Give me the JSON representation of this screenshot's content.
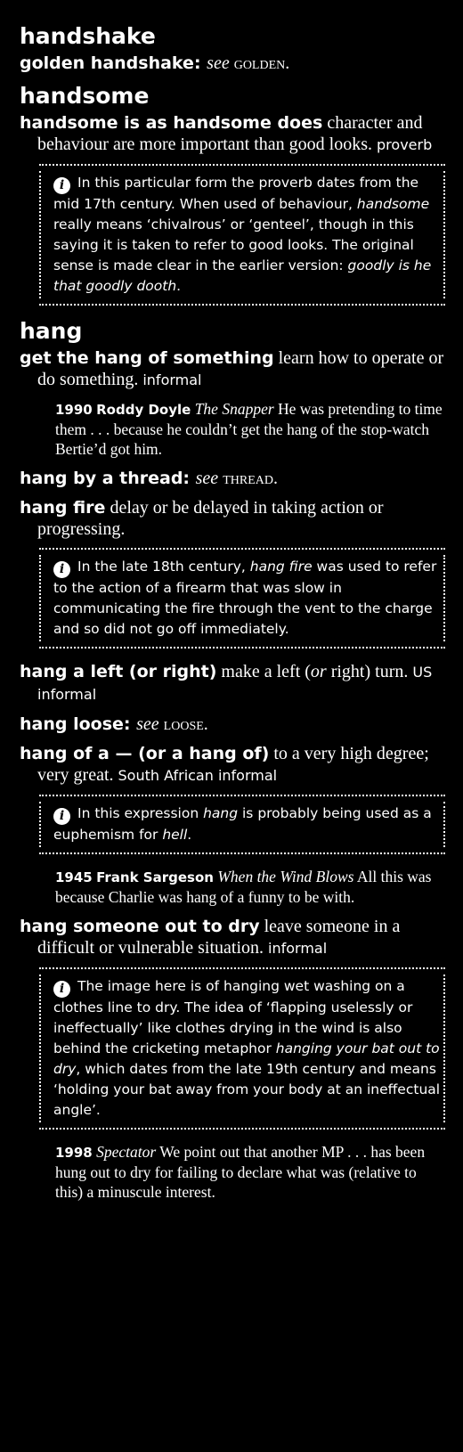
{
  "sections": {
    "handshake": {
      "headword": "handshake",
      "e1": {
        "phrase": "golden handshake",
        "sep": ": ",
        "see": "see",
        "ref": "golden",
        "end": "."
      }
    },
    "handsome": {
      "headword": "handsome",
      "e1": {
        "phrase": "handsome is as handsome does",
        "def": " character and behaviour are more important than good looks.",
        "label": "proverb",
        "note": {
          "t1": "In this particular form the proverb dates from the mid 17th century. When used of behaviour, ",
          "i1": "handsome",
          "t2": " really means ‘chivalrous’ or ‘genteel’, though in this saying it is taken to refer to good looks. The original sense is made clear in the earlier version: ",
          "i2": "goodly is he that goodly dooth",
          "t3": "."
        }
      }
    },
    "hang": {
      "headword": "hang",
      "e1": {
        "phrase": "get the hang of something",
        "def": " learn how to operate or do something.",
        "label": "informal",
        "cite": {
          "year": "1990",
          "author": "Roddy Doyle",
          "title": "The Snapper",
          "text": " He was pretending to time them . . . because he couldn’t get the hang of the stop-watch Bertie’d got him."
        }
      },
      "e2": {
        "phrase": "hang by a thread",
        "sep": ": ",
        "see": "see",
        "ref": "thread",
        "end": "."
      },
      "e3": {
        "phrase": "hang fire",
        "def": " delay or be delayed in taking action or progressing.",
        "note": {
          "t1": "In the late 18th century, ",
          "i1": "hang fire",
          "t2": " was used to refer to the action of a firearm that was slow in communicating the fire through the vent to the charge and so did not go off immediately."
        }
      },
      "e4": {
        "phrase": "hang a left",
        "open": " (",
        "or": "or",
        "alt": " right)",
        "def1": " make a left (",
        "def_or": "or",
        "def2": " right) turn.",
        "label": "US informal"
      },
      "e5": {
        "phrase": "hang loose",
        "sep": ": ",
        "see": "see",
        "ref": "loose",
        "end": "."
      },
      "e6": {
        "phrase": "hang of a —",
        "open": " (",
        "or": "or",
        "alt": " a hang of)",
        "def": " to a very high degree; very great.",
        "label": "South African informal",
        "note": {
          "t1": "In this expression ",
          "i1": "hang",
          "t2": " is probably being used as a euphemism for ",
          "i2": "hell",
          "t3": "."
        },
        "cite": {
          "year": "1945",
          "author": "Frank Sargeson",
          "title": "When the Wind Blows",
          "text": " All this was because Charlie was hang of a funny to be with."
        }
      },
      "e7": {
        "phrase": "hang someone out to dry",
        "def": " leave someone in a difficult or vulnerable situation.",
        "label": "informal",
        "note": {
          "t1": "The image here is of hanging wet washing on a clothes line to dry. The idea of ‘flapping uselessly or ineffectually’ like clothes drying in the wind is also behind the cricketing metaphor ",
          "i1": "hanging your bat out to dry",
          "t2": ", which dates from the late 19th century and means ‘holding your bat away from your body at an ineffectual angle’."
        },
        "cite": {
          "year": "1998",
          "author": "",
          "title": "Spectator",
          "text": " We point out that another MP . . . has been hung out to dry for failing to declare what was (relative to this) a minuscule interest."
        }
      }
    }
  },
  "colors": {
    "background": "#000000",
    "text": "#ffffff"
  },
  "icons": {
    "info": "info-icon"
  }
}
